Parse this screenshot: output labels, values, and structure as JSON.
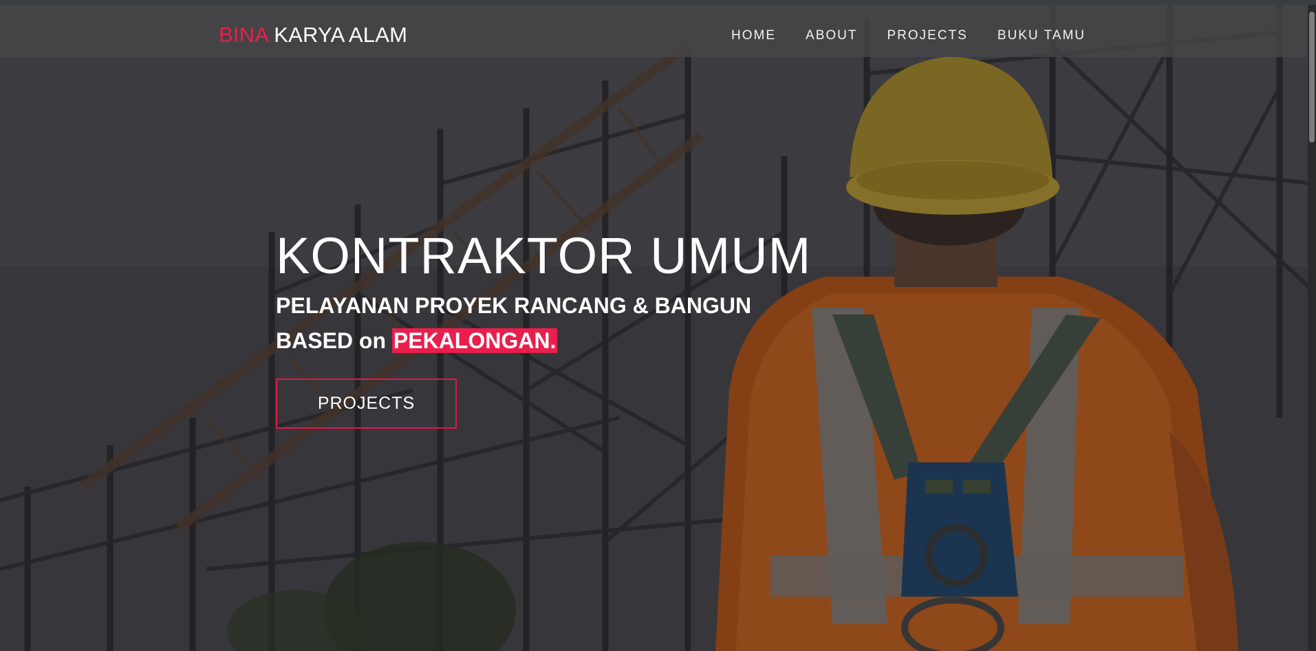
{
  "brand": {
    "accent_word": "BINA",
    "rest": " KARYA ALAM"
  },
  "nav": {
    "items": [
      {
        "label": "HOME"
      },
      {
        "label": "ABOUT"
      },
      {
        "label": "PROJECTS"
      },
      {
        "label": "BUKU TAMU"
      }
    ]
  },
  "hero": {
    "title": "KONTRAKTOR UMUM",
    "subtitle_line1": "PELAYANAN PROYEK RANCANG & BANGUN",
    "subtitle_line2_prefix": "BASED on ",
    "subtitle_line2_highlight": "PEKALONGAN.",
    "cta_label": "PROJECTS"
  },
  "colors": {
    "accent": "#ea1e4c",
    "navbar_bg": "#464648",
    "text": "#ffffff"
  }
}
